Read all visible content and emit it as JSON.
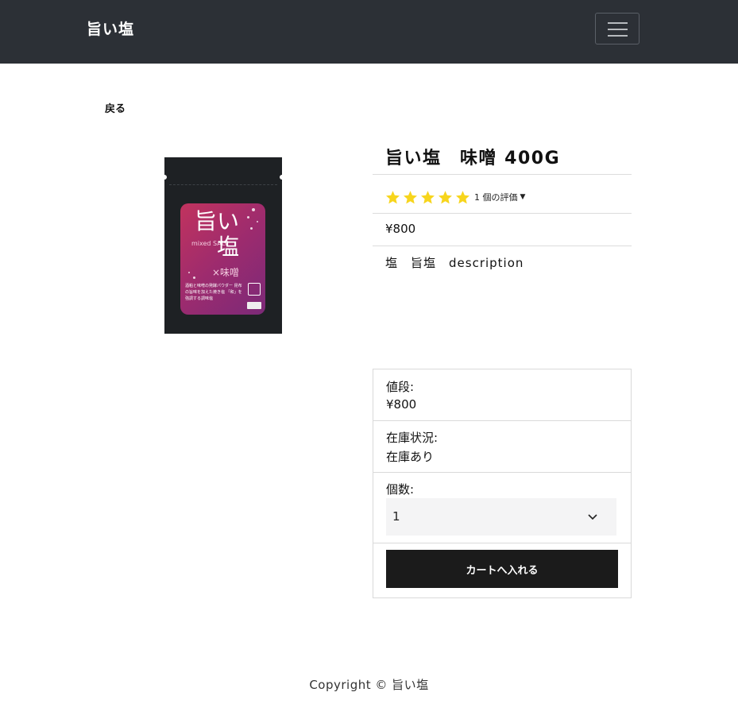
{
  "navbar": {
    "brand": "旨い塩",
    "menu_icon": "hamburger-icon",
    "background": "#2c3036"
  },
  "back_link": "戻る",
  "product": {
    "title": "旨い塩　味噌 400G",
    "rating": {
      "stars": 5,
      "max_stars": 5,
      "text": "1 個の評価",
      "star_color": "#f7d51d"
    },
    "price": "¥800",
    "description": "塩　旨塩　description",
    "image_text": {
      "big_char_1": "旨い",
      "big_char_2": "塩",
      "mixed_salt": "mixed SALT",
      "flavor": "×味噌",
      "blurb": "酒粕と味噌の発酵パウダー 昆布の旨味を加えた焼き塩 「和」を強調する調味塩"
    }
  },
  "purchase_card": {
    "price_label": "値段:",
    "price_value": "¥800",
    "stock_label": "在庫状況:",
    "stock_value": "在庫あり",
    "quantity_label": "個数:",
    "quantity_selected": "1",
    "add_to_cart": "カートへ入れる",
    "button_color": "#1b1b1b"
  },
  "footer": {
    "copyright": "Copyright © 旨い塩"
  }
}
